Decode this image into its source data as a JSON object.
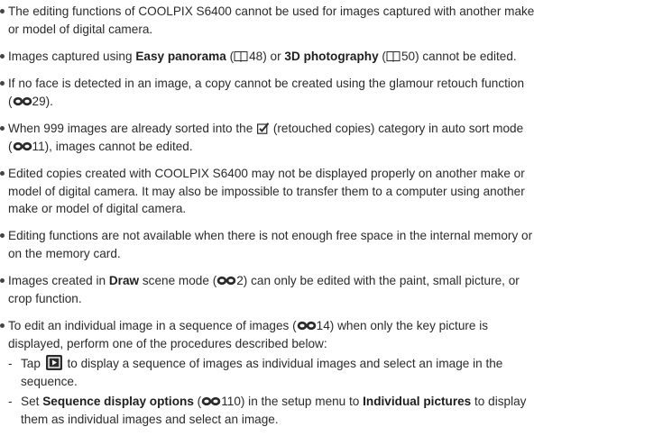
{
  "icons": {
    "book": "book-reference-icon",
    "link": "chain-link-reference-icon",
    "retouched": "retouch-checkmark-icon",
    "playback": "playback-button-icon"
  },
  "b1": {
    "t1": "The editing functions of COOLPIX S6400 cannot be used for images captured with another make",
    "t2": "or model of digital camera."
  },
  "b2": {
    "t1": "Images captured using ",
    "bold1": "Easy panorama",
    "t2": " (",
    "p1": "48",
    "t3": ") or ",
    "bold2": "3D photography",
    "t4": " (",
    "p2": "50",
    "t5": ") cannot be edited."
  },
  "b3": {
    "t1": "If no face is detected in an image, a copy cannot be created using the glamour retouch function",
    "t2": "(",
    "p1": "29",
    "t3": ")."
  },
  "b4": {
    "t1": "When 999 images are already sorted into the ",
    "t2": " (retouched copies) category in auto sort mode",
    "t3": "(",
    "p1": "11",
    "t4": "), images cannot be edited."
  },
  "b5": {
    "l1": "Edited copies created with COOLPIX S6400 may not be displayed properly on another make or",
    "l2": "model of digital camera. It may also be impossible to transfer them to a computer using another",
    "l3": "make or model of digital camera."
  },
  "b6": {
    "l1": "Editing functions are not available when there is not enough free space in the internal memory or",
    "l2": "on the memory card."
  },
  "b7": {
    "t1": "Images created in ",
    "bold1": "Draw",
    "t2": " scene mode (",
    "p1": "2",
    "t3": ") can only be edited with the paint, small picture, or",
    "t4": "crop function."
  },
  "b8": {
    "t1": "To edit an individual image in a sequence of images (",
    "p1": "14",
    "t2": ") when only the key picture is",
    "t3": "displayed, perform one of the procedures described below:"
  },
  "s1": {
    "dash": "-",
    "t1": "Tap ",
    "t2": " to display a sequence of images as individual images and select an image in the",
    "t3": "sequence."
  },
  "s2": {
    "dash": "-",
    "t1": "Set ",
    "bold1": "Sequence display options",
    "t2": " (",
    "p1": "110",
    "t3": ") in the setup menu to ",
    "bold2": "Individual pictures",
    "t4": " to display",
    "t5": "them as individual images and select an image."
  }
}
